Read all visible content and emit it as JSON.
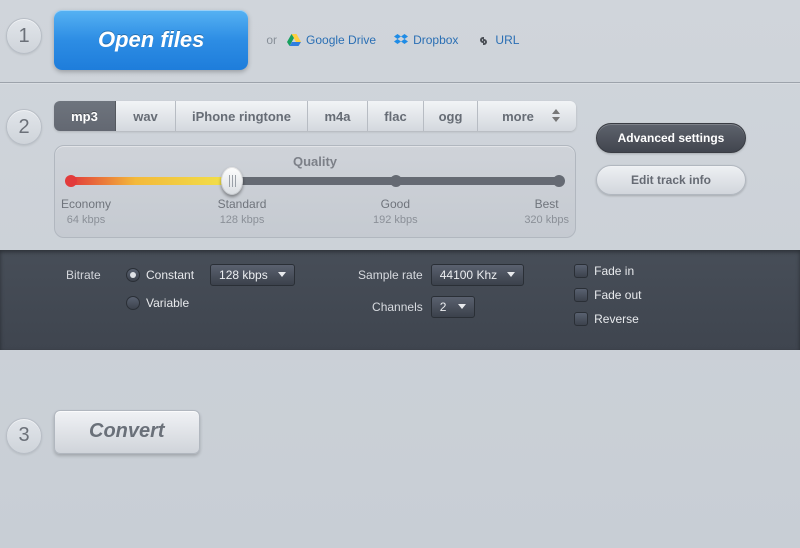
{
  "steps": {
    "s1": "1",
    "s2": "2",
    "s3": "3"
  },
  "open": {
    "button_label": "Open files",
    "or_text": "or",
    "google_drive": "Google Drive",
    "dropbox": "Dropbox",
    "url": "URL"
  },
  "formats": {
    "mp3": "mp3",
    "wav": "wav",
    "iphone": "iPhone ringtone",
    "m4a": "m4a",
    "flac": "flac",
    "ogg": "ogg",
    "more": "more"
  },
  "quality": {
    "title": "Quality",
    "economy": "Economy",
    "economy_rate": "64 kbps",
    "standard": "Standard",
    "standard_rate": "128 kbps",
    "good": "Good",
    "good_rate": "192 kbps",
    "best": "Best",
    "best_rate": "320 kbps"
  },
  "side": {
    "advanced": "Advanced settings",
    "edit_track": "Edit track info"
  },
  "advanced": {
    "bitrate_label": "Bitrate",
    "constant": "Constant",
    "variable": "Variable",
    "bitrate_value": "128 kbps",
    "sample_rate_label": "Sample rate",
    "sample_rate_value": "44100 Khz",
    "channels_label": "Channels",
    "channels_value": "2",
    "fade_in": "Fade in",
    "fade_out": "Fade out",
    "reverse": "Reverse"
  },
  "convert": {
    "label": "Convert"
  }
}
